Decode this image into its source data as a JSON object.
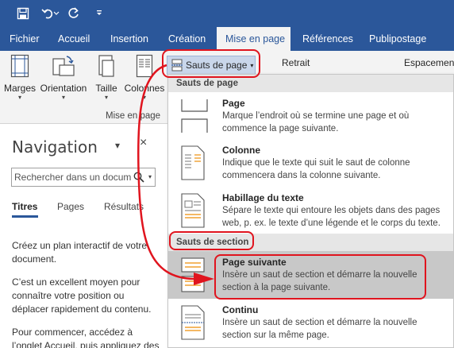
{
  "tabs": {
    "fichier": "Fichier",
    "accueil": "Accueil",
    "insertion": "Insertion",
    "creation": "Création",
    "mise_en_page": "Mise en page",
    "references": "Références",
    "publipostage": "Publipostage"
  },
  "ribbon": {
    "marges": "Marges",
    "orientation": "Orientation",
    "taille": "Taille",
    "colonnes": "Colonnes",
    "group_label": "Mise en page",
    "sauts_de_page": "Sauts de page",
    "retrait": "Retrait",
    "espacement": "Espacement"
  },
  "navigation": {
    "title": "Navigation",
    "close": "×",
    "search_placeholder": "Rechercher dans un docum",
    "tabs": [
      "Titres",
      "Pages",
      "Résultats"
    ],
    "p1": "Créez un plan interactif de votre document.",
    "p2": "C’est un excellent moyen pour connaître votre position ou déplacer rapidement du contenu.",
    "p3": "Pour commencer, accédez à l’onglet Accueil, puis appliquez des"
  },
  "menu": {
    "section_page": "Sauts de page",
    "section_section": "Sauts de section",
    "items": [
      {
        "title": "Page",
        "desc": "Marque l’endroit où se termine une page et où commence la page suivante."
      },
      {
        "title": "Colonne",
        "desc": "Indique que le texte qui suit le saut de colonne commencera dans la colonne suivante."
      },
      {
        "title": "Habillage du texte",
        "desc": "Sépare le texte qui entoure les objets dans des pages web, p. ex. le texte d’une légende et le corps du texte."
      },
      {
        "title": "Page suivante",
        "desc": "Insère un saut de section et démarre la nouvelle section à la page suivante."
      },
      {
        "title": "Continu",
        "desc": "Insère un saut de section et démarre la nouvelle section sur la même page."
      }
    ]
  },
  "colors": {
    "brand": "#2b579a",
    "annotation": "#e0141e",
    "hover": "#c8c8c8"
  }
}
